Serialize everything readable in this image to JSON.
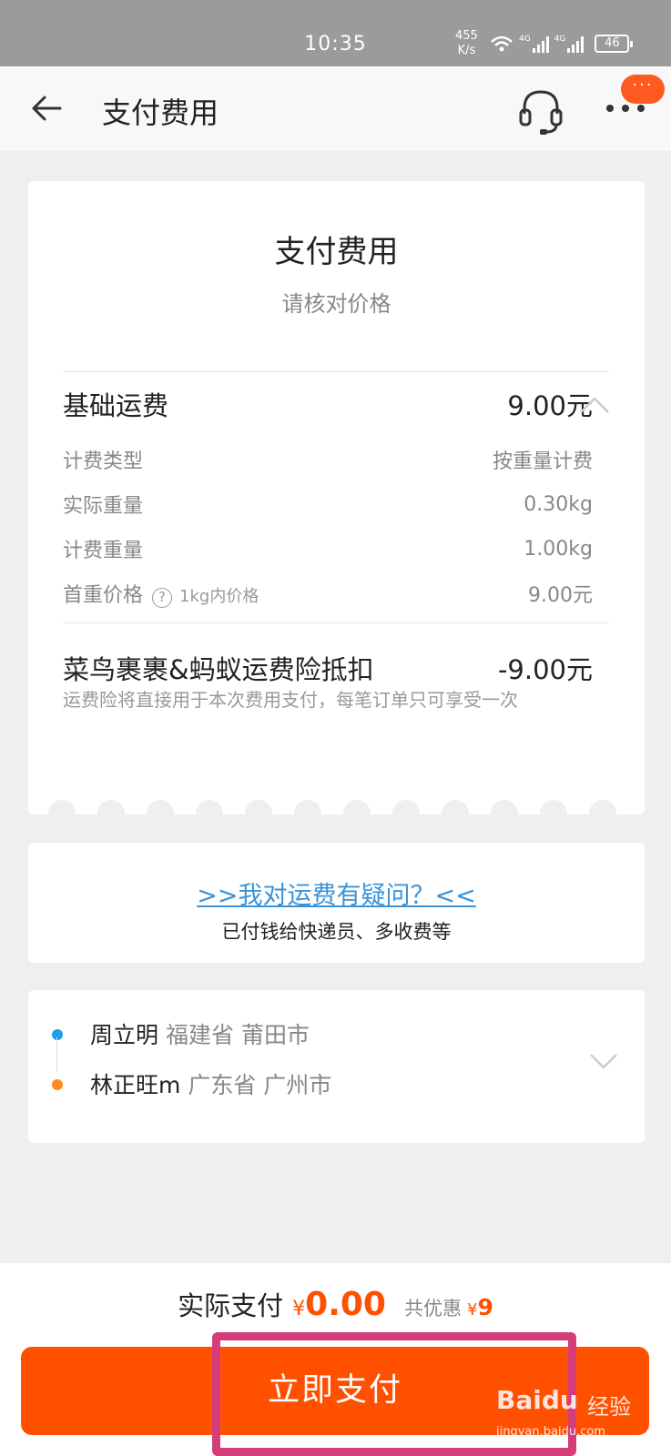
{
  "status_bar": {
    "time": "10:35",
    "speed_value": "455",
    "speed_unit": "K/s",
    "network_1": "4G",
    "network_2": "4G",
    "battery": "46"
  },
  "nav": {
    "title": "支付费用",
    "back_icon": "arrow-left-icon",
    "service_icon": "headset-icon",
    "more_icon": "more-dots-icon",
    "more_badge": "···"
  },
  "fee_card": {
    "title": "支付费用",
    "subtitle": "请核对价格",
    "base_fee_label": "基础运费",
    "base_fee_value": "9.00元",
    "details": [
      {
        "label": "计费类型",
        "value": "按重量计费"
      },
      {
        "label": "实际重量",
        "value": "0.30kg"
      },
      {
        "label": "计费重量",
        "value": "1.00kg"
      },
      {
        "label": "首重价格",
        "value": "9.00元"
      }
    ],
    "first_weight_hint_icon": "?",
    "first_weight_hint": "1kg内价格",
    "insurance_label": "菜鸟裹裹&蚂蚁运费险抵扣",
    "insurance_value": "-9.00元",
    "insurance_note": "运费险将直接用于本次费用支付，每笔订单只可享受一次"
  },
  "question_card": {
    "link": ">>我对运费有疑问？<<",
    "subtext": "已付钱给快递员、多收费等"
  },
  "route_card": {
    "sender_name": "周立明",
    "sender_location": "福建省 莆田市",
    "receiver_name": "林正旺m",
    "receiver_location": "广东省 广州市"
  },
  "bottom_bar": {
    "total_label": "实际支付",
    "total_currency": "¥",
    "total_value": "0.00",
    "discount_label": "共优惠",
    "discount_currency": "¥",
    "discount_value": "9",
    "pay_button": "立即支付"
  },
  "watermark": {
    "brand": "Baidu",
    "word": "经验",
    "url": "jingyan.baidu.com"
  },
  "colors": {
    "accent": "#ff5000",
    "link": "#3a93d8",
    "sender_dot": "#1a9fe8",
    "receiver_dot": "#ff8a1f",
    "highlight_border": "#d53d7a"
  }
}
